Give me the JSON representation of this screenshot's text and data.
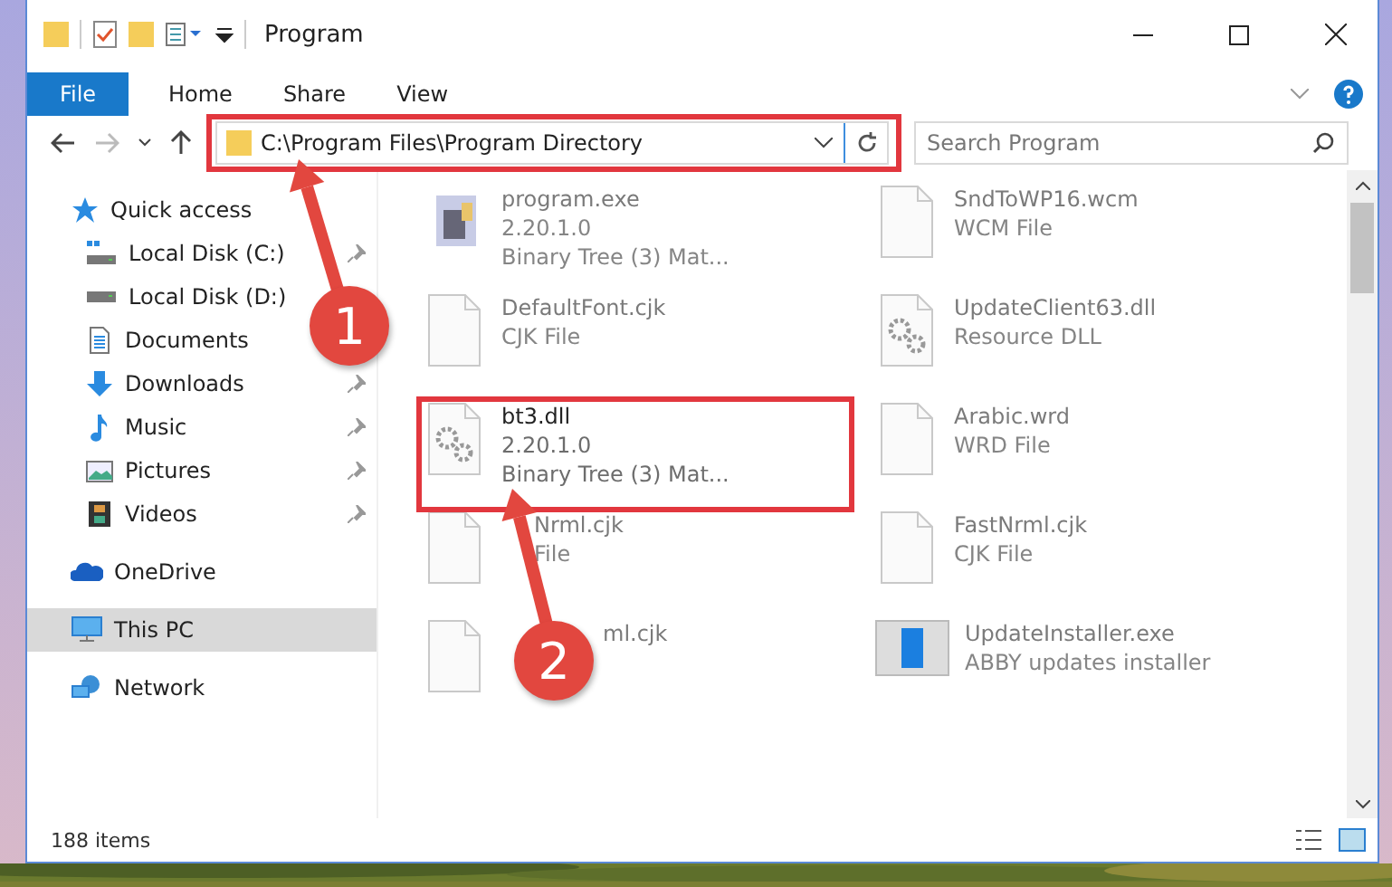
{
  "window": {
    "title": "Program"
  },
  "ribbon_tabs": [
    {
      "label": "File",
      "selected": true
    },
    {
      "label": "Home",
      "selected": false
    },
    {
      "label": "Share",
      "selected": false
    },
    {
      "label": "View",
      "selected": false
    }
  ],
  "address_bar": {
    "path": "C:\\Program Files\\Program Directory"
  },
  "search": {
    "placeholder": "Search Program"
  },
  "sidebar": {
    "items": [
      {
        "label": "Quick access",
        "kind": "quick-access",
        "pinned": false,
        "selected": false
      },
      {
        "label": "Local Disk (C:)",
        "kind": "system-drive",
        "pinned": true,
        "selected": false
      },
      {
        "label": "Local Disk (D:)",
        "kind": "drive",
        "pinned": false,
        "selected": false
      },
      {
        "label": "Documents",
        "kind": "documents",
        "pinned": false,
        "selected": false
      },
      {
        "label": "Downloads",
        "kind": "downloads",
        "pinned": true,
        "selected": false
      },
      {
        "label": "Music",
        "kind": "music",
        "pinned": true,
        "selected": false
      },
      {
        "label": "Pictures",
        "kind": "pictures",
        "pinned": true,
        "selected": false
      },
      {
        "label": "Videos",
        "kind": "videos",
        "pinned": true,
        "selected": false
      },
      {
        "label": "OneDrive",
        "kind": "onedrive",
        "pinned": false,
        "selected": false
      },
      {
        "label": "This PC",
        "kind": "this-pc",
        "pinned": false,
        "selected": true
      },
      {
        "label": "Network",
        "kind": "network",
        "pinned": false,
        "selected": false
      }
    ]
  },
  "files": [
    {
      "name": "program.exe",
      "lines": [
        "2.20.1.0",
        "Binary Tree (3) Mat..."
      ],
      "kind": "application",
      "blurred": true
    },
    {
      "name": "SndToWP16.wcm",
      "lines": [
        "WCM File"
      ],
      "kind": "file",
      "blurred": true
    },
    {
      "name": "DefaultFont.cjk",
      "lines": [
        "CJK File"
      ],
      "kind": "file",
      "blurred": true
    },
    {
      "name": "UpdateClient63.dll",
      "lines": [
        "Resource DLL"
      ],
      "kind": "library",
      "blurred": true
    },
    {
      "name": "bt3.dll",
      "lines": [
        "2.20.1.0",
        "Binary Tree (3) Mat..."
      ],
      "kind": "library",
      "blurred": false
    },
    {
      "name": "Arabic.wrd",
      "lines": [
        "WRD File"
      ],
      "kind": "file",
      "blurred": true
    },
    {
      "name": "Nrml.cjk",
      "lines": [
        "File"
      ],
      "kind": "file",
      "blurred": true
    },
    {
      "name": "FastNrml.cjk",
      "lines": [
        "CJK File"
      ],
      "kind": "file",
      "blurred": true
    },
    {
      "name": "ml.cjk",
      "kind": "file",
      "blurred": true
    },
    {
      "name": "UpdateInstaller.exe",
      "lines": [
        "ABBY updates installer"
      ],
      "kind": "installer",
      "blurred": true
    }
  ],
  "annotations": [
    {
      "number": "1"
    },
    {
      "number": "2"
    }
  ],
  "status_bar": {
    "count": "188 items"
  }
}
